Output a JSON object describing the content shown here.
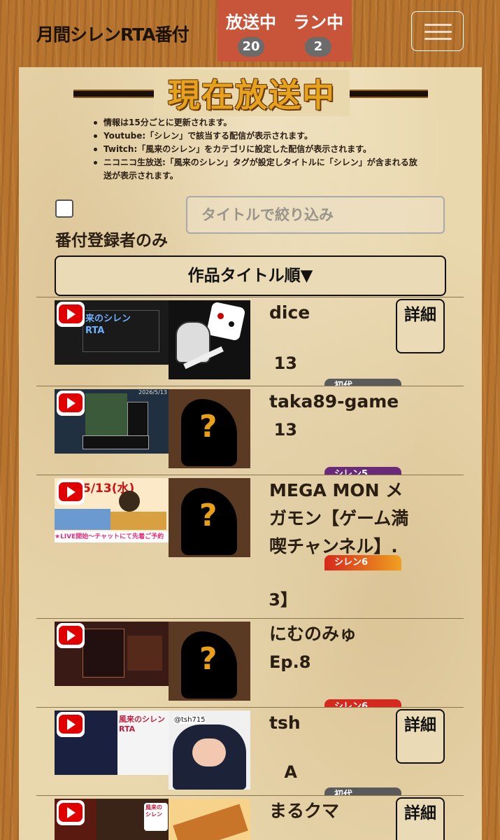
{
  "header": {
    "site_title": "月間シレンRTA番付",
    "broadcasting": {
      "label": "放送中",
      "count": "20"
    },
    "running": {
      "label": "ラン中",
      "count": "2"
    }
  },
  "banner": {
    "title": "現在放送中"
  },
  "notes": [
    "情報は15分ごとに更新されます。",
    "Youtube:「シレン」で該当する配信が表示されます。",
    "Twitch:「風来のシレン」をカテゴリに設定した配信が表示されます。",
    "ニコニコ生放送:「風来のシレン」タグが設定しタイトルに「シレン」が含まれる放",
    "送が表示されます。"
  ],
  "filter": {
    "checkbox_label": "番付登録者のみ",
    "search_placeholder": "タイトルで絞り込み",
    "sort_label": "作品タイトル順▼"
  },
  "detail_label": "詳細",
  "thumb_text": {
    "row1": "来のシレン RTA",
    "row3_date": "5/13(水)",
    "row3_sub": "★LIVE開始〜チャットにて先着ご予約",
    "row5": "風来のシレン RTA",
    "row6": "風来の シレン",
    "row2_date": "2026/5/13"
  },
  "streams": [
    {
      "name": "dice",
      "meta": "13",
      "badge": "初代",
      "badge_color": "#5a5a5a"
    },
    {
      "name": "taka89-game",
      "meta": "13",
      "badge": "シレン5",
      "badge_color": "#6a2a7a"
    },
    {
      "name": "MEGA MON メガモン【ゲーム満喫チャンネル】.",
      "meta": "13】",
      "badge": "シレン6",
      "badge_color": "#d6281c"
    },
    {
      "name": "にむのみゅ",
      "meta": "Ep.8",
      "badge": "シレン6",
      "badge_color": "#d6281c"
    },
    {
      "name": "tsh",
      "meta": "A",
      "badge": "初代",
      "badge_color": "#5a5a5a",
      "avatar_tag": "@tsh715"
    },
    {
      "name": "まるクマ",
      "meta": "",
      "badge": "",
      "badge_color": ""
    }
  ]
}
